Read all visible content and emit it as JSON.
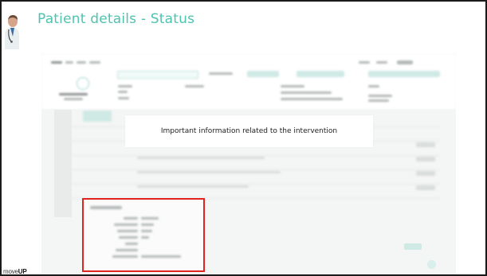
{
  "slide": {
    "title": "Patient details - Status"
  },
  "callout": {
    "text": "Important information related to the intervention"
  },
  "logo": {
    "prefix": "move",
    "suffix": "UP"
  },
  "colors": {
    "title": "#4fc3b0",
    "highlight_border": "#e0231f",
    "frame_border": "#1a1a1a",
    "callout_bg": "#ffffff"
  },
  "icons": {
    "avatar": "doctor-avatar-icon"
  }
}
